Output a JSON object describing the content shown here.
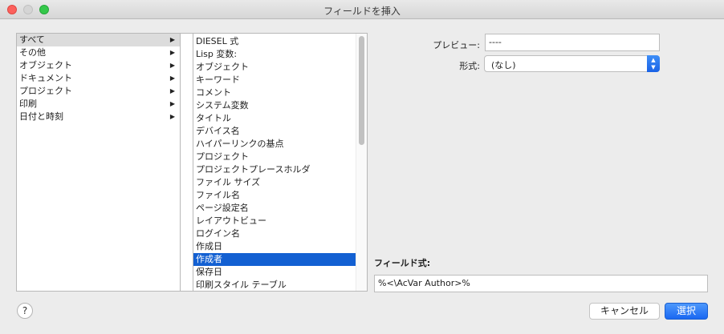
{
  "window": {
    "title": "フィールドを挿入"
  },
  "categories": [
    {
      "label": "すべて",
      "selected": true
    },
    {
      "label": "その他"
    },
    {
      "label": "オブジェクト"
    },
    {
      "label": "ドキュメント"
    },
    {
      "label": "プロジェクト"
    },
    {
      "label": "印刷"
    },
    {
      "label": "日付と時刻"
    }
  ],
  "category_arrow": "▶",
  "fields": [
    {
      "label": "DIESEL 式"
    },
    {
      "label": "Lisp 変数:"
    },
    {
      "label": "オブジェクト"
    },
    {
      "label": "キーワード"
    },
    {
      "label": "コメント"
    },
    {
      "label": "システム変数"
    },
    {
      "label": "タイトル"
    },
    {
      "label": "デバイス名"
    },
    {
      "label": "ハイパーリンクの基点"
    },
    {
      "label": "プロジェクト"
    },
    {
      "label": "プロジェクトプレースホルダ"
    },
    {
      "label": "ファイル サイズ"
    },
    {
      "label": "ファイル名"
    },
    {
      "label": "ページ設定名"
    },
    {
      "label": "レイアウトビュー"
    },
    {
      "label": "ログイン名"
    },
    {
      "label": "作成日"
    },
    {
      "label": "作成者",
      "selected": true
    },
    {
      "label": "保存日"
    },
    {
      "label": "印刷スタイル テーブル"
    }
  ],
  "preview": {
    "label": "プレビュー:",
    "value": "----"
  },
  "format": {
    "label": "形式:",
    "value": "(なし)"
  },
  "field_expression": {
    "label": "フィールド式:",
    "value": "%<\\AcVar Author>%"
  },
  "buttons": {
    "help": "?",
    "cancel": "キャンセル",
    "ok": "選択"
  },
  "colors": {
    "selection": "#1360d2",
    "primary_button": "#1a68f2"
  }
}
